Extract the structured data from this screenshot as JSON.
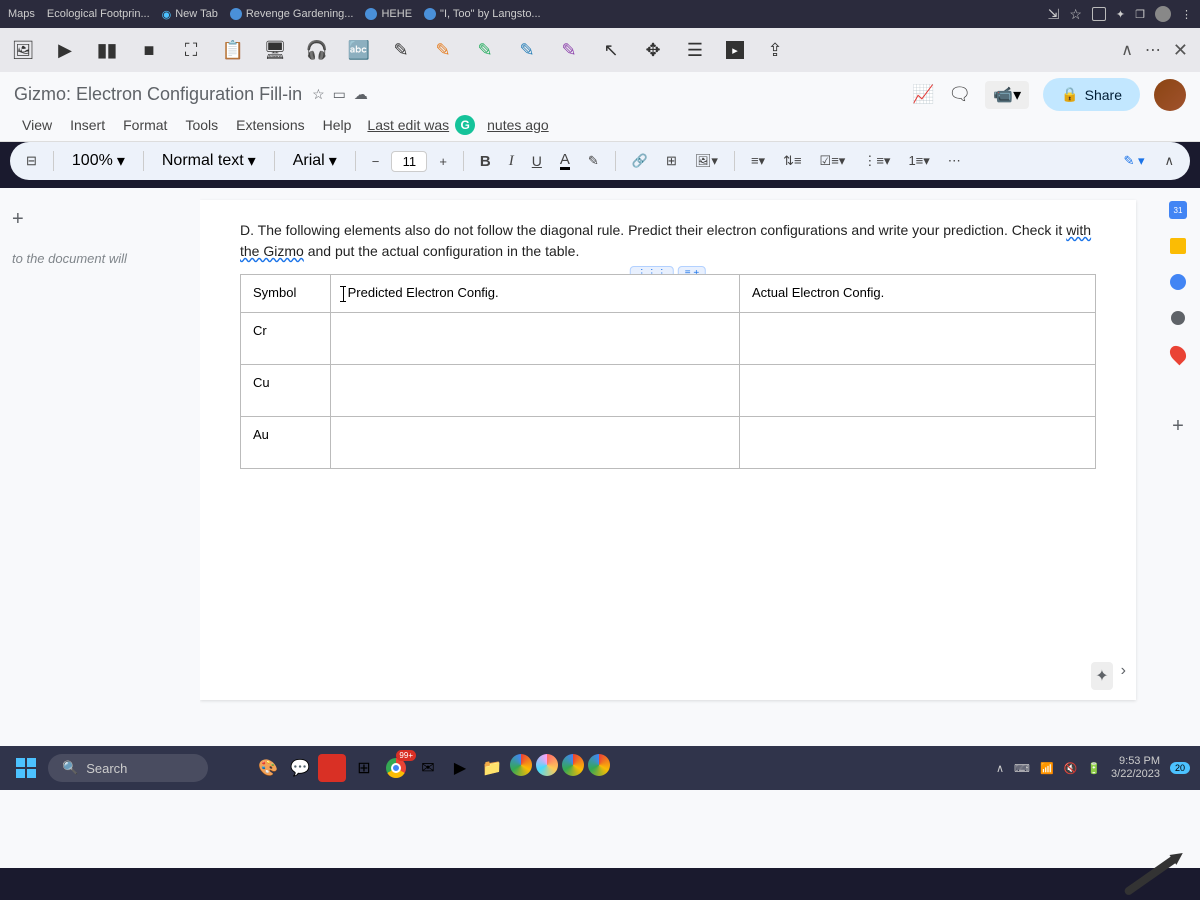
{
  "browser": {
    "tabs": [
      {
        "label": "Maps"
      },
      {
        "label": "Ecological Footprin..."
      },
      {
        "label": "New Tab"
      },
      {
        "label": "Revenge Gardening..."
      },
      {
        "label": "HEHE"
      },
      {
        "label": "\"I, Too\" by Langsto..."
      }
    ]
  },
  "doc": {
    "title": "Gizmo: Electron Configuration Fill-in",
    "last_edit_prefix": "Last edit was",
    "last_edit_suffix": "nutes ago",
    "menus": [
      "View",
      "Insert",
      "Format",
      "Tools",
      "Extensions",
      "Help"
    ],
    "share_label": "Share"
  },
  "toolbar": {
    "zoom": "100%",
    "style": "Normal text",
    "font": "Arial",
    "font_size": "11"
  },
  "content": {
    "question_prefix": "D.   The following elements also do not follow the diagonal rule.  Predict their electron configurations and write your prediction.  Check it ",
    "question_wavy": "with the Gizmo",
    "question_suffix": " and put the actual configuration in the table.",
    "table": {
      "headers": [
        "Symbol",
        "Predicted Electron Config.",
        "Actual Electron Config."
      ],
      "rows": [
        "Cr",
        "Cu",
        "Au"
      ]
    }
  },
  "sidebar": {
    "outline_hint": "to the document will",
    "calendar_day": "31"
  },
  "taskbar": {
    "search_placeholder": "Search",
    "time": "9:53 PM",
    "date": "3/22/2023",
    "notif_count": "20"
  }
}
